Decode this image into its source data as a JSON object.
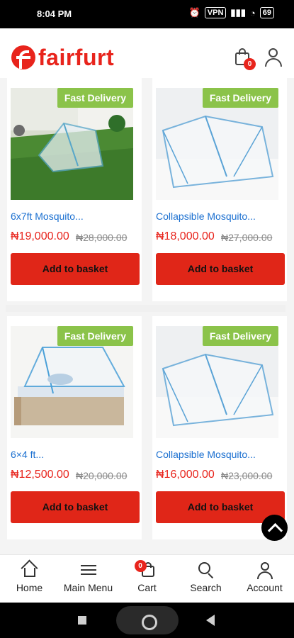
{
  "status": {
    "time": "8:04 PM",
    "icons": [
      "alarm-icon",
      "vpn-icon",
      "signal-icon",
      "vowifi-icon",
      "wifi-icon",
      "battery-icon"
    ],
    "vpn_label": "VPN",
    "battery_label": "69"
  },
  "header": {
    "brand": "fairfurt",
    "cart_count": "0"
  },
  "products": [
    {
      "tag": "Fast Delivery",
      "name": "6x7ft Mosquito...",
      "price": "₦19,000.00",
      "old_price": "₦28,000.00",
      "button": "Add to basket"
    },
    {
      "tag": "Fast Delivery",
      "name": "Collapsible Mosquito...",
      "price": "₦18,000.00",
      "old_price": "₦27,000.00",
      "button": "Add to basket"
    },
    {
      "tag": "Fast Delivery",
      "name": "6×4 ft...",
      "price": "₦12,500.00",
      "old_price": "₦20,000.00",
      "button": "Add to basket"
    },
    {
      "tag": "Fast Delivery",
      "name": "Collapsible Mosquito...",
      "price": "₦16,000.00",
      "old_price": "₦23,000.00",
      "button": "Add to basket"
    }
  ],
  "bottom_nav": [
    {
      "label": "Home",
      "icon": "home-icon"
    },
    {
      "label": "Main Menu",
      "icon": "menu-icon"
    },
    {
      "label": "Cart",
      "icon": "cart-icon",
      "badge": "0"
    },
    {
      "label": "Search",
      "icon": "search-icon"
    },
    {
      "label": "Account",
      "icon": "account-icon"
    }
  ],
  "colors": {
    "brand": "#e8241c",
    "tag": "#8bc34a",
    "link": "#1a6fd0"
  }
}
